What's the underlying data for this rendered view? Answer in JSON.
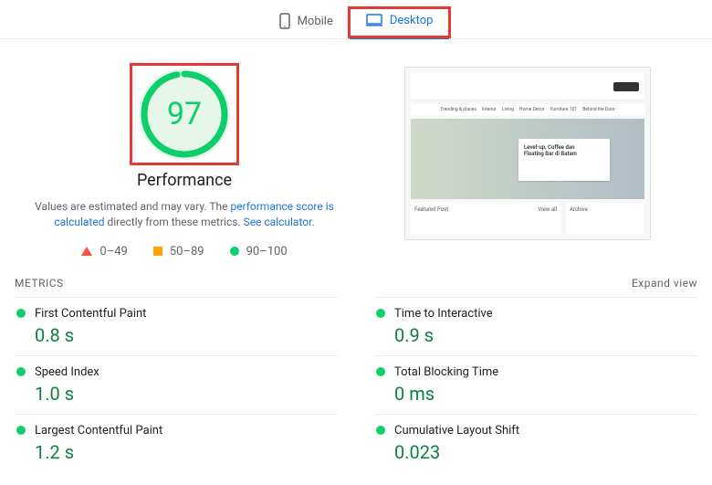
{
  "tabs": {
    "mobile": "Mobile",
    "desktop": "Desktop"
  },
  "score": "97",
  "scoreLabel": "Performance",
  "caption_prefix": "Values are estimated and may vary. The ",
  "caption_link1": "performance score is calculated",
  "caption_mid": " directly from these metrics. ",
  "caption_link2": "See calculator.",
  "legend": {
    "poor": "0–49",
    "avg": "50–89",
    "good": "90–100"
  },
  "thumb": {
    "title1": "Level-up, Coffee dan",
    "title2": "Floating Bar di Batam",
    "featured": "Featured Post",
    "archive": "Archive",
    "viewall": "View all"
  },
  "metricsHeader": "METRICS",
  "expand": "Expand view",
  "metrics": [
    {
      "name": "First Contentful Paint",
      "value": "0.8 s"
    },
    {
      "name": "Time to Interactive",
      "value": "0.9 s"
    },
    {
      "name": "Speed Index",
      "value": "1.0 s"
    },
    {
      "name": "Total Blocking Time",
      "value": "0 ms"
    },
    {
      "name": "Largest Contentful Paint",
      "value": "1.2 s"
    },
    {
      "name": "Cumulative Layout Shift",
      "value": "0.023"
    }
  ]
}
